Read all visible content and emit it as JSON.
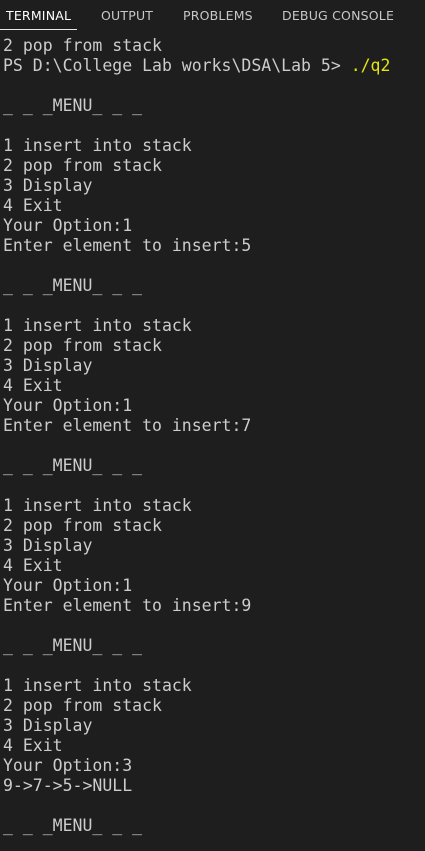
{
  "tabs": [
    {
      "label": "TERMINAL",
      "active": true
    },
    {
      "label": "OUTPUT",
      "active": false
    },
    {
      "label": "PROBLEMS",
      "active": false
    },
    {
      "label": "DEBUG CONSOLE",
      "active": false
    }
  ],
  "colors": {
    "background": "#1e1e1e",
    "text": "#cccccc",
    "command": "#e5e510",
    "active_tab_underline": "#e7e7e7"
  },
  "terminal": {
    "lines": [
      "2 pop from stack",
      "PS D:\\College Lab works\\DSA\\Lab 5> ",
      "",
      "_ _ _MENU_ _ _",
      "",
      "1 insert into stack",
      "2 pop from stack",
      "3 Display",
      "4 Exit",
      "Your Option:1",
      "Enter element to insert:5",
      "",
      "_ _ _MENU_ _ _",
      "",
      "1 insert into stack",
      "2 pop from stack",
      "3 Display",
      "4 Exit",
      "Your Option:1",
      "Enter element to insert:7",
      "",
      "_ _ _MENU_ _ _",
      "",
      "1 insert into stack",
      "2 pop from stack",
      "3 Display",
      "4 Exit",
      "Your Option:1",
      "Enter element to insert:9",
      "",
      "_ _ _MENU_ _ _",
      "",
      "1 insert into stack",
      "2 pop from stack",
      "3 Display",
      "4 Exit",
      "Your Option:3",
      "9->7->5->NULL",
      "",
      "_ _ _MENU_ _ _"
    ],
    "command": "./q2"
  }
}
